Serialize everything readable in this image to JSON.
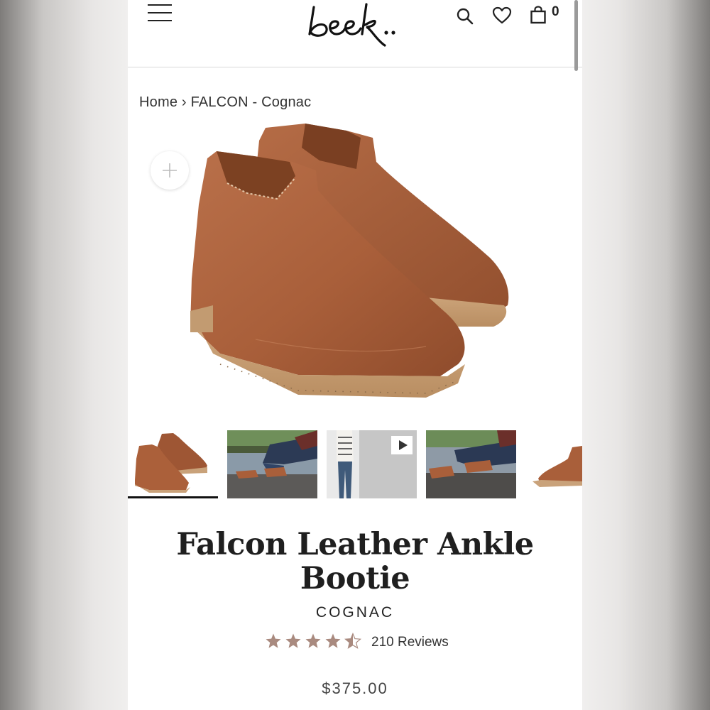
{
  "header": {
    "icons": [
      "menu-icon",
      "search-icon",
      "heart-icon",
      "bag-icon"
    ],
    "logo_text": "beek..",
    "cart_count": "0"
  },
  "breadcrumb": {
    "home": "Home",
    "separator": "›",
    "current": "FALCON - Cognac"
  },
  "gallery": {
    "zoom_icon": "plus-icon",
    "thumbnails": [
      "boots-pair",
      "model-seated",
      "model-standing-video",
      "model-seated-closeup",
      "boot-side"
    ],
    "video_icon": "play-icon",
    "active_index": 0
  },
  "product": {
    "title": "Falcon Leather Ankle Bootie",
    "color": "COGNAC",
    "rating": 4.5,
    "rating_max": 5,
    "reviews_label": "210 Reviews",
    "price": "$375.00"
  },
  "colors": {
    "leather": "#a95f3a",
    "sole": "#c9a27a",
    "star": "#a98a7f",
    "text": "#1f1f1f"
  }
}
